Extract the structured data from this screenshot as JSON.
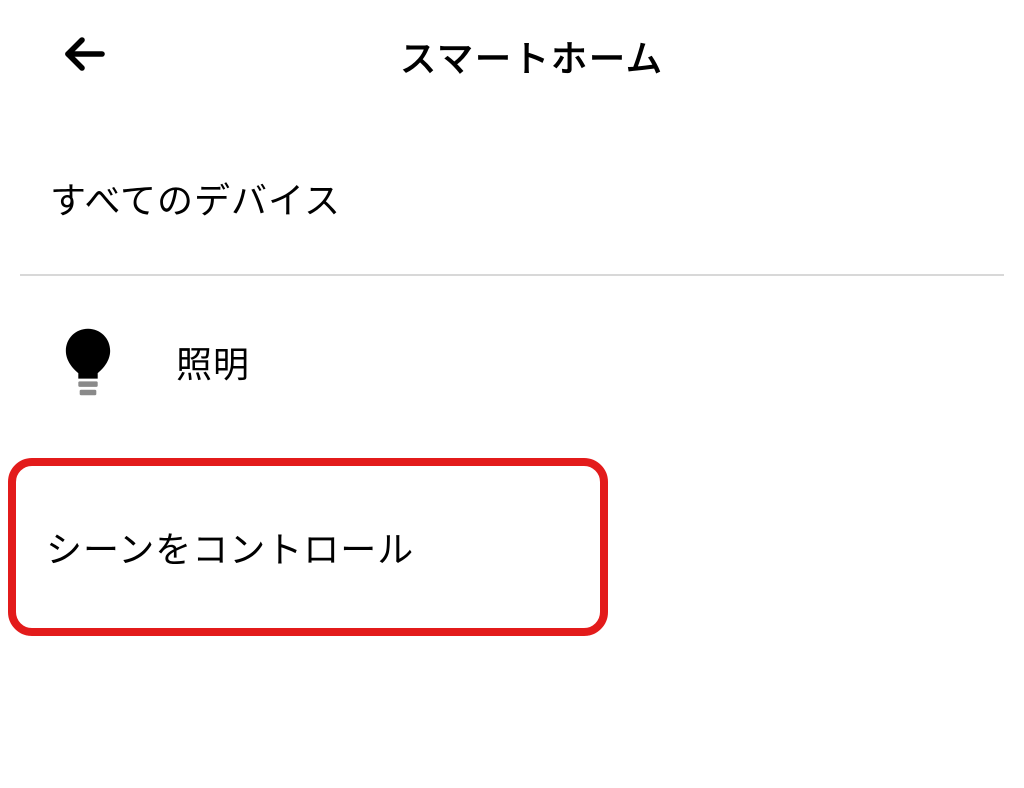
{
  "header": {
    "title": "スマートホーム"
  },
  "items": {
    "all_devices": "すべてのデバイス",
    "lighting": "照明",
    "scene_control": "シーンをコントロール"
  }
}
